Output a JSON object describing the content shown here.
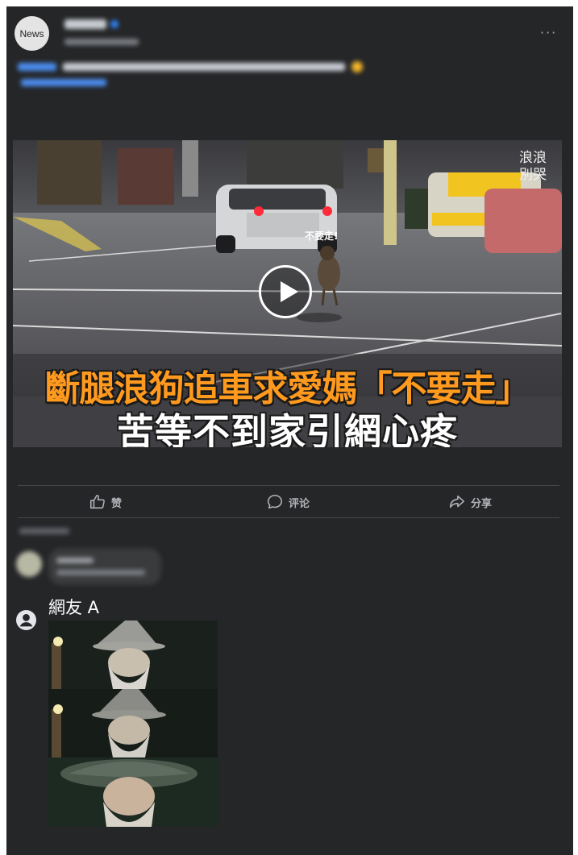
{
  "post": {
    "page_avatar_label": "News",
    "poster_name": "",
    "timestamp": "",
    "caption": ""
  },
  "video": {
    "watermark_line1": "浪浪",
    "watermark_line2": "別哭",
    "speech_bubble": "不要走!",
    "headline_line1": "斷腿浪狗追車求愛媽「不要走」",
    "headline_line2": "苦等不到家引網心疼"
  },
  "actions": {
    "like_label": "赞",
    "comment_label": "评论",
    "share_label": "分享"
  },
  "comment": {
    "author": "網友 A",
    "attachment": "meme-image-three-panels"
  },
  "colors": {
    "card_bg": "#252628",
    "headline_orange": "#ff9a1f",
    "link_blue": "#4b8df0"
  }
}
